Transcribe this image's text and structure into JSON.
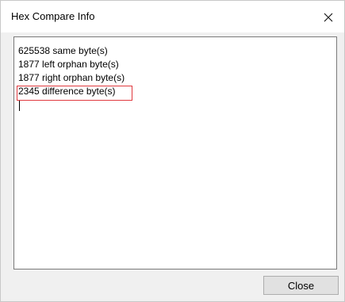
{
  "window": {
    "title": "Hex Compare Info",
    "close_icon": "close-icon"
  },
  "info": {
    "lines": [
      "625538 same byte(s)",
      "1877 left orphan byte(s)",
      "1877 right orphan byte(s)",
      "2345 difference byte(s)"
    ],
    "highlight_color": "#e0393e"
  },
  "buttons": {
    "close_label": "Close"
  }
}
